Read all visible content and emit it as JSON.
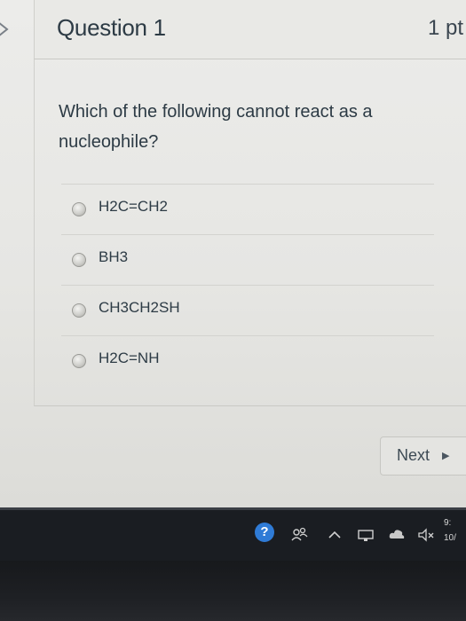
{
  "question": {
    "title": "Question 1",
    "points": "1 pt",
    "text": "Which of the following cannot react as a nucleophile?",
    "answers": [
      {
        "label": "H2C=CH2"
      },
      {
        "label": "BH3"
      },
      {
        "label": "CH3CH2SH"
      },
      {
        "label": "H2C=NH"
      }
    ]
  },
  "navigation": {
    "next_label": "Next",
    "next_arrow": "▶"
  },
  "taskbar": {
    "help_glyph": "?",
    "clock_time": "9:",
    "clock_date": "10/",
    "icons": [
      "help-icon",
      "people-icon",
      "chevron-up-icon",
      "network-icon",
      "cloud-icon",
      "volume-muted-icon"
    ]
  },
  "colors": {
    "text": "#2d3b45",
    "taskbar": "#1a1d22",
    "help_icon": "#2f7bd6"
  }
}
